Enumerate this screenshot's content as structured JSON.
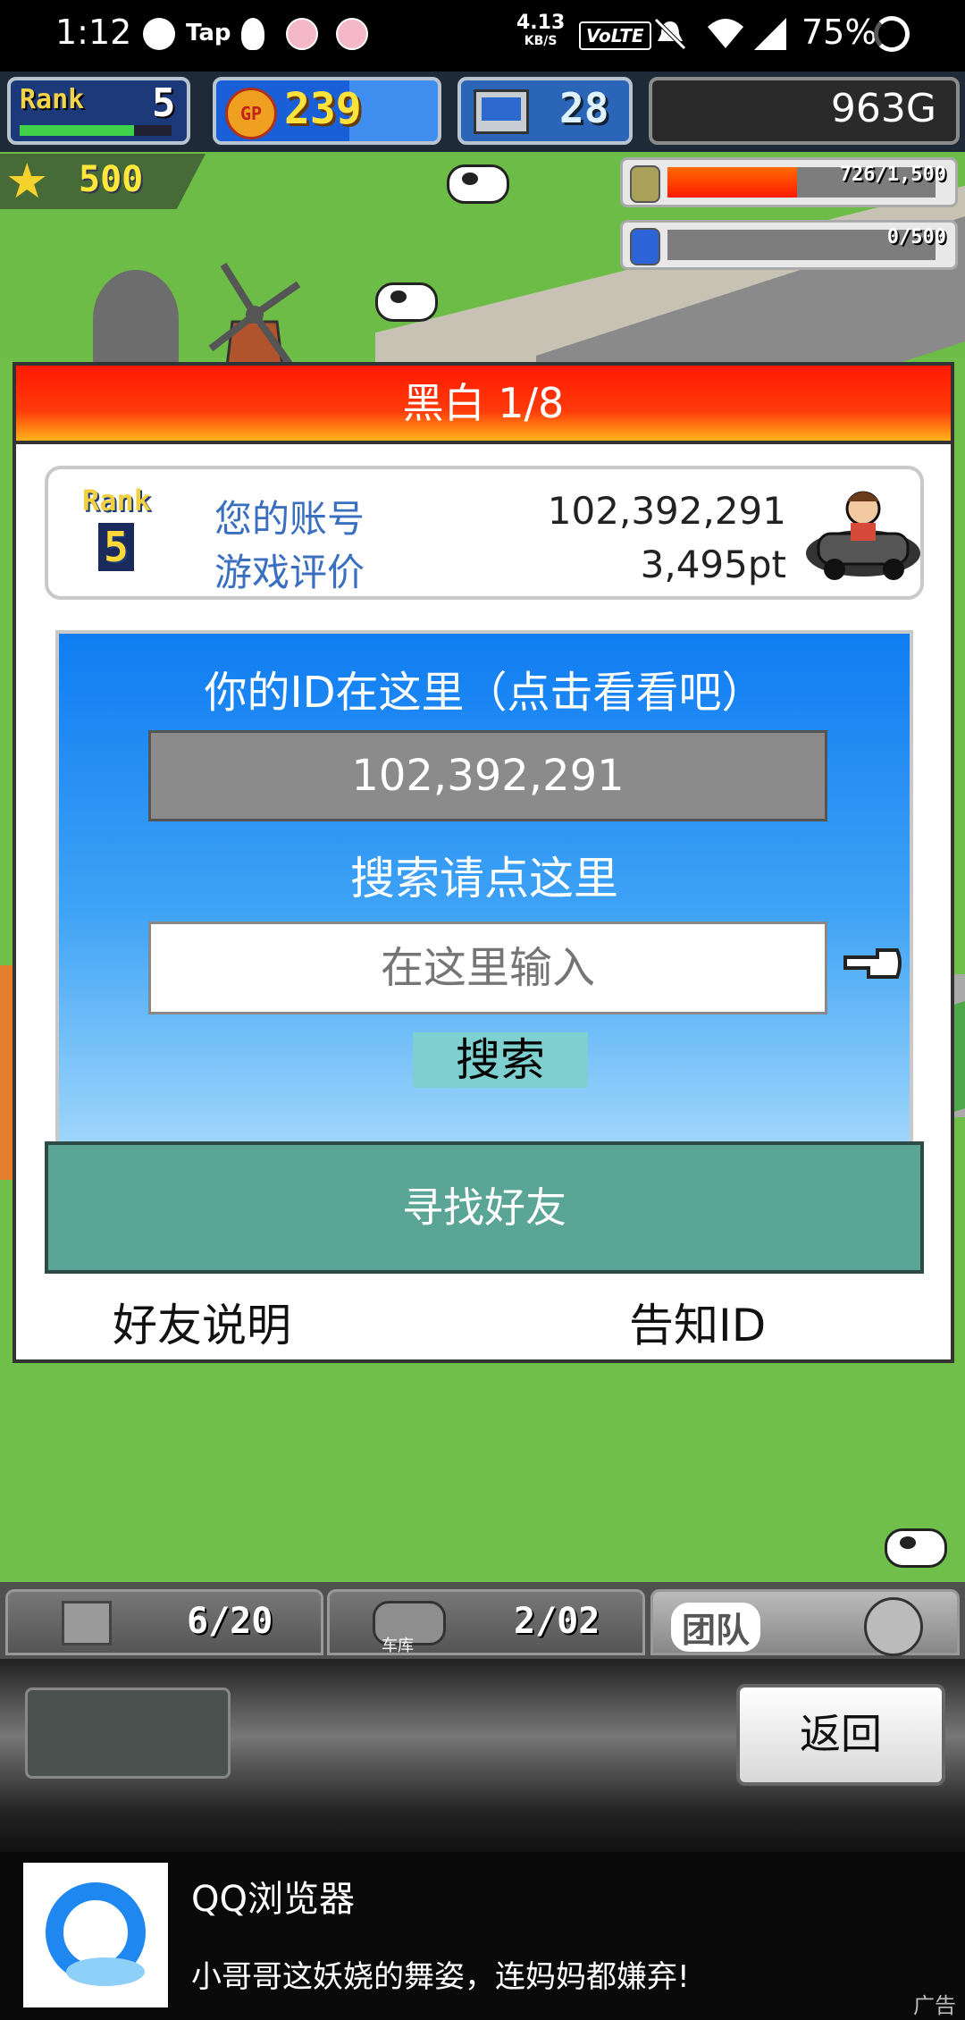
{
  "status_bar": {
    "time": "1:12",
    "tap_label": "Tap",
    "net_speed": "4.13",
    "net_unit": "KB/S",
    "volte": "VoLTE",
    "battery": "75%"
  },
  "hud": {
    "rank_label": "Rank",
    "rank_value": "5",
    "gp_icon_label": "GP",
    "gp_value": "239",
    "staff_value": "28",
    "money": "963G",
    "star_value": "500",
    "resource1": "726/1,500",
    "resource1_fill": 0.484,
    "resource2": "0/500",
    "resource2_fill": 0.0
  },
  "dialog": {
    "title": "黑白 1/8",
    "rank_label": "Rank",
    "rank_value": "5",
    "account_label": "您的账号",
    "account_value": "102,392,291",
    "rating_label": "游戏评价",
    "rating_value": "3,495pt",
    "id_heading": "你的ID在这里（点击看看吧）",
    "id_value": "102,392,291",
    "search_heading": "搜索请点这里",
    "search_placeholder": "在这里输入",
    "search_button": "搜索",
    "find_friend_button": "寻找好友",
    "friend_help_link": "好友说明",
    "notify_id_link": "告知ID"
  },
  "tabs": {
    "items_count": "6/20",
    "garage_label": "车库",
    "garage_count": "2/02",
    "team_label": "团队"
  },
  "bottom": {
    "back_button": "返回"
  },
  "ad": {
    "title": "QQ浏览器",
    "text": "小哥哥这妖娆的舞姿，连妈妈都嫌弃!",
    "tag": "广告"
  },
  "colors": {
    "title_red": "#ff1a00",
    "panel_blue": "#0f7cf2",
    "find_button": "#5aa595",
    "gp_yellow": "#ffe23a"
  }
}
